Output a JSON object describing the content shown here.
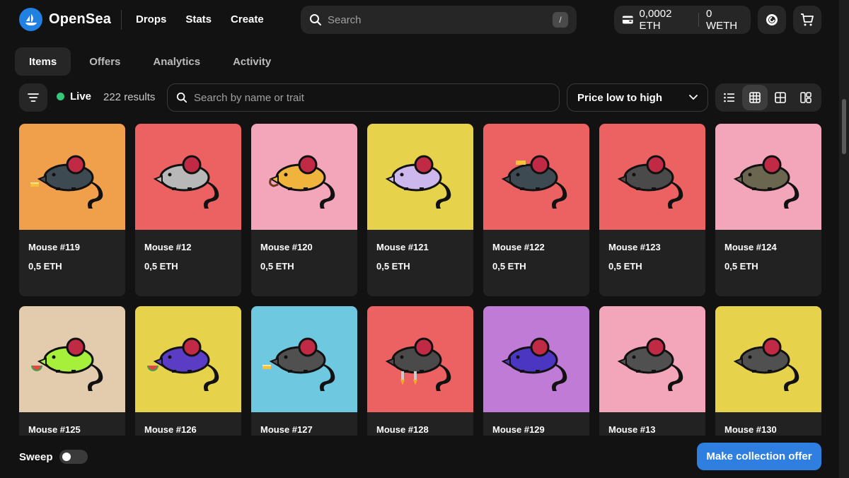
{
  "brand": {
    "name": "OpenSea",
    "color": "#2081e2"
  },
  "nav": {
    "links": [
      "Drops",
      "Stats",
      "Create"
    ]
  },
  "search": {
    "placeholder": "Search",
    "shortcut": "/"
  },
  "wallet": {
    "eth": "0,0002 ETH",
    "weth": "0 WETH"
  },
  "tabs": [
    {
      "label": "Items",
      "active": true
    },
    {
      "label": "Offers",
      "active": false
    },
    {
      "label": "Analytics",
      "active": false
    },
    {
      "label": "Activity",
      "active": false
    }
  ],
  "filter": {
    "live_label": "Live",
    "results": "222 results",
    "trait_placeholder": "Search by name or trait",
    "sort": "Price low to high"
  },
  "items": [
    {
      "name": "Mouse #119",
      "price": "0,5 ETH",
      "bg": "#f0a04b",
      "mouse": "#3e4a52",
      "accessory": "cheese"
    },
    {
      "name": "Mouse #12",
      "price": "0,5 ETH",
      "bg": "#ec6161",
      "mouse": "#b8b8b8",
      "accessory": ""
    },
    {
      "name": "Mouse #120",
      "price": "0,5 ETH",
      "bg": "#f3a6b9",
      "mouse": "#f0b43c",
      "accessory": "pipe"
    },
    {
      "name": "Mouse #121",
      "price": "0,5 ETH",
      "bg": "#e7d24b",
      "mouse": "#cdb8ee",
      "accessory": ""
    },
    {
      "name": "Mouse #122",
      "price": "0,5 ETH",
      "bg": "#ec6161",
      "mouse": "#3e4a52",
      "accessory": "hat"
    },
    {
      "name": "Mouse #123",
      "price": "0,5 ETH",
      "bg": "#ec6161",
      "mouse": "#4a4a4a",
      "accessory": ""
    },
    {
      "name": "Mouse #124",
      "price": "0,5 ETH",
      "bg": "#f3a6b9",
      "mouse": "#6b6650",
      "accessory": ""
    },
    {
      "name": "Mouse #125",
      "price": "",
      "bg": "#e3ccad",
      "mouse": "#a6f03c",
      "accessory": "watermelon"
    },
    {
      "name": "Mouse #126",
      "price": "",
      "bg": "#e7d24b",
      "mouse": "#5b3cc4",
      "accessory": "watermelon"
    },
    {
      "name": "Mouse #127",
      "price": "",
      "bg": "#6dc8e0",
      "mouse": "#505050",
      "accessory": "cheese"
    },
    {
      "name": "Mouse #128",
      "price": "",
      "bg": "#ec6161",
      "mouse": "#4a4a4a",
      "accessory": "rockets"
    },
    {
      "name": "Mouse #129",
      "price": "",
      "bg": "#c07bd6",
      "mouse": "#4a36c0",
      "accessory": ""
    },
    {
      "name": "Mouse #13",
      "price": "",
      "bg": "#f3a6b9",
      "mouse": "#505050",
      "accessory": ""
    },
    {
      "name": "Mouse #130",
      "price": "",
      "bg": "#e7d24b",
      "mouse": "#505050",
      "accessory": ""
    }
  ],
  "bottom": {
    "sweep_label": "Sweep",
    "offer_button": "Make collection offer"
  },
  "icons": [
    "opensea-logo-icon",
    "search-icon",
    "wallet-icon",
    "profile-icon",
    "cart-icon",
    "filter-icon",
    "chevron-down-icon",
    "list-view-icon",
    "grid-view-icon",
    "large-grid-view-icon",
    "mosaic-view-icon"
  ]
}
